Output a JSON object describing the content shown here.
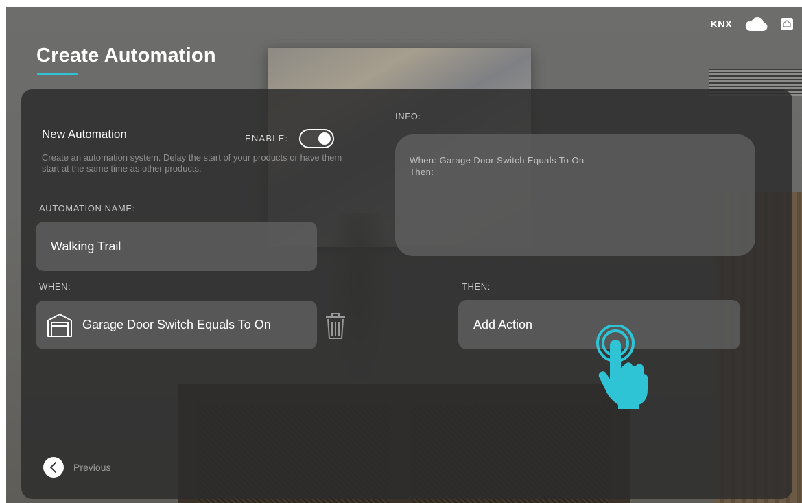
{
  "header": {
    "title": "Create Automation",
    "status": {
      "knx_label": "KNX",
      "icons": [
        "cloud-icon",
        "home-icon"
      ]
    }
  },
  "form": {
    "heading": "New Automation",
    "description": "Create an automation system. Delay the start of your products or have them start at the same time as other products.",
    "enable_label": "ENABLE:",
    "enable_state": "on",
    "automation_name_label": "AUTOMATION NAME:",
    "automation_name_value": "Walking Trail",
    "when_label": "WHEN:",
    "when_value": "Garage Door Switch Equals To On",
    "when_icon": "garage-icon",
    "then_label": "THEN:",
    "then_value": "Add Action"
  },
  "info": {
    "label": "INFO:",
    "when_text": "When: Garage Door Switch Equals To On",
    "then_text": "Then:"
  },
  "nav": {
    "previous_label": "Previous"
  },
  "colors": {
    "accent": "#2ec4d6",
    "panel": "#2c2c2c",
    "field": "#5f5f5f"
  }
}
